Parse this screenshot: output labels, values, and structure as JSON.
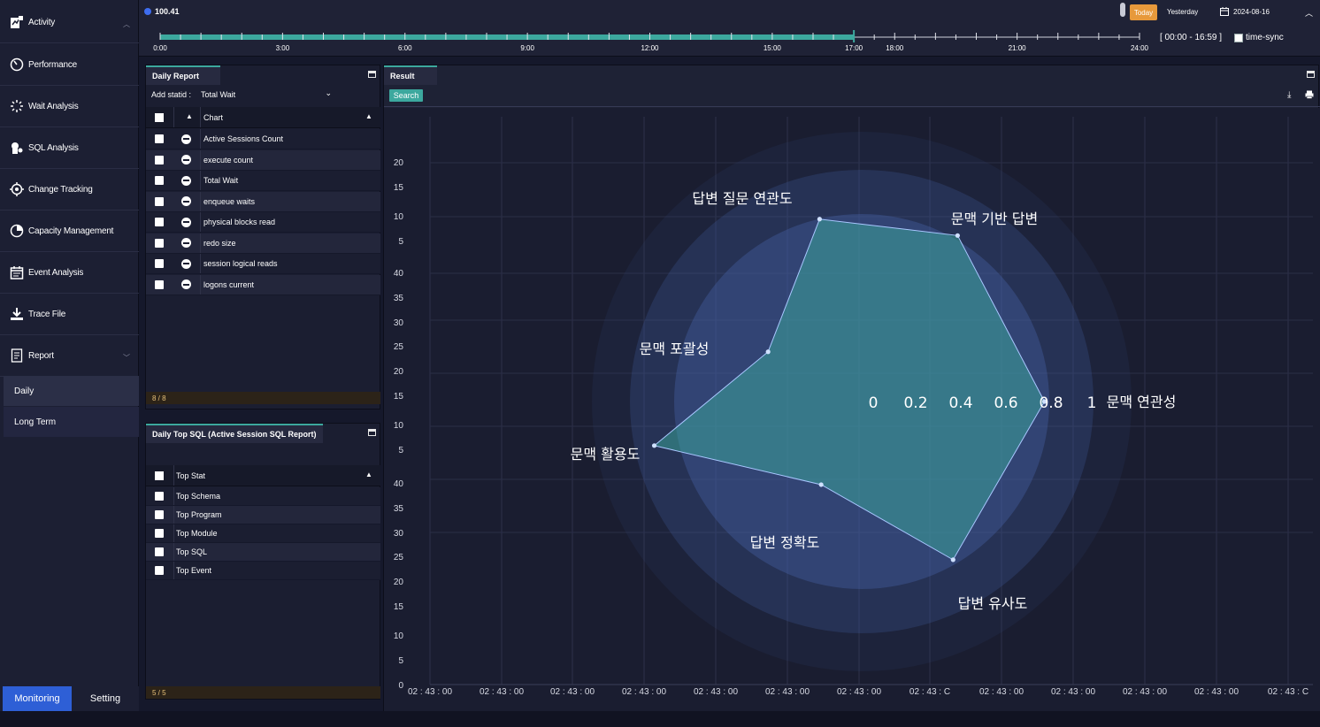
{
  "sidebar": {
    "items": [
      {
        "label": "Activity",
        "icon": "activity-icon"
      },
      {
        "label": "Performance",
        "icon": "performance-icon"
      },
      {
        "label": "Wait Analysis",
        "icon": "wait-icon"
      },
      {
        "label": "SQL Analysis",
        "icon": "sql-icon"
      },
      {
        "label": "Change Tracking",
        "icon": "change-icon"
      },
      {
        "label": "Capacity Management",
        "icon": "capacity-icon"
      },
      {
        "label": "Event Analysis",
        "icon": "event-icon"
      },
      {
        "label": "Trace File",
        "icon": "trace-icon"
      },
      {
        "label": "Report",
        "icon": "report-icon"
      }
    ],
    "sub_items": [
      {
        "label": "Daily"
      },
      {
        "label": "Long Term"
      }
    ],
    "bottom_tabs": {
      "monitoring": "Monitoring",
      "setting": "Setting"
    }
  },
  "topbar": {
    "db_name": "100.41",
    "today": "Today",
    "yesterday": "Yesterday",
    "date": "2024-08-16",
    "time_range": "[ 00:00 - 16:59 ]",
    "time_sync": "time-sync",
    "timeline_labels": [
      "0:00",
      "3:00",
      "6:00",
      "9:00",
      "12:00",
      "15:00",
      "17:00",
      "18:00",
      "21:00",
      "24:00"
    ],
    "progress_hours": 17
  },
  "daily_report": {
    "tab": "Daily Report",
    "add_statid_label": "Add statid :",
    "add_statid_value": "Total Wait",
    "column_header": "Chart",
    "rows": [
      "Active Sessions Count",
      "execute count",
      "Total Wait",
      "enqueue waits",
      "physical blocks read",
      "redo size",
      "session logical reads",
      "logons current"
    ],
    "counter": "8 / 8"
  },
  "top_sql": {
    "tab": "Daily Top SQL (Active Session SQL Report)",
    "column_header": "Top Stat",
    "rows": [
      "Top Schema",
      "Top Program",
      "Top Module",
      "Top SQL",
      "Top Event"
    ],
    "counter": "5 / 5"
  },
  "result": {
    "tab": "Result",
    "search": "Search",
    "y_ticks_group1": [
      "20",
      "15",
      "10",
      "5"
    ],
    "y_ticks_group2": [
      "40",
      "35",
      "30",
      "25",
      "20",
      "15",
      "10",
      "5"
    ],
    "y_ticks_group3": [
      "40",
      "35",
      "30",
      "25",
      "20",
      "15",
      "10",
      "5",
      "0"
    ],
    "x_ticks": [
      "02 : 43 : 00",
      "02 : 43 : 00",
      "02 : 43 : 00",
      "02 : 43 : 00",
      "02 : 43 : 00",
      "02 : 43 : 00",
      "02 : 43 : 00",
      "02 : 43 : C",
      "02 : 43 : 00",
      "02 : 43 : 00",
      "02 : 43 : 00",
      "02 : 43 : 00",
      "02 : 43 : C"
    ]
  },
  "chart_data": {
    "type": "radar",
    "radial_ticks": [
      "0",
      "0.2",
      "0.4",
      "0.6",
      "0.8",
      "1"
    ],
    "axes": [
      "문맥 연관성",
      "문맥 기반 답변",
      "답변 질문 연관도",
      "문맥 포괄성",
      "문맥 활용도",
      "답변 정확도",
      "답변 유사도"
    ],
    "values": [
      0.81,
      0.85,
      0.83,
      0.47,
      0.94,
      0.41,
      0.81
    ]
  }
}
